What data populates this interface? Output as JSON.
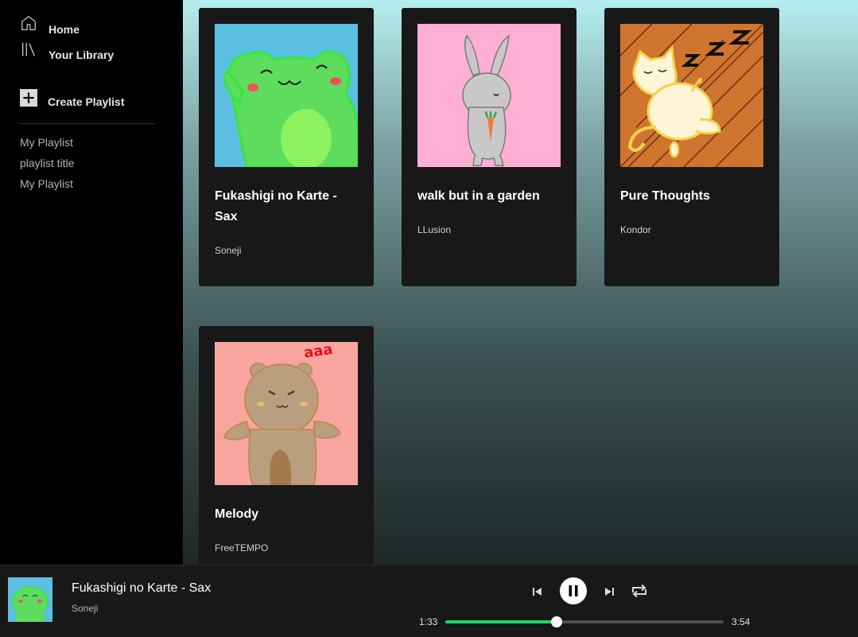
{
  "sidebar": {
    "home_label": "Home",
    "library_label": "Your Library",
    "create_playlist_label": "Create Playlist",
    "playlists": [
      "My Playlist",
      "playlist title",
      "My Playlist"
    ]
  },
  "cards": [
    {
      "title": "Fukashigi no Karte - Sax",
      "artist": "Soneji",
      "cover": "frog-illustration"
    },
    {
      "title": "walk but in a garden",
      "artist": "LLusion",
      "cover": "bunny-illustration"
    },
    {
      "title": "Pure Thoughts",
      "artist": "Kondor",
      "cover": "sleeping-cat-illustration"
    },
    {
      "title": "Melody",
      "artist": "FreeTEMPO",
      "cover": "bear-illustration",
      "cover_text": "aaa"
    }
  ],
  "player": {
    "title": "Fukashigi no Karte - Sax",
    "artist": "Soneji",
    "elapsed": "1:33",
    "duration": "3:54",
    "progress_fraction": 0.4,
    "state": "playing"
  },
  "colors": {
    "accent": "#1ed760",
    "card_bg": "#181818",
    "sidebar_bg": "#000000"
  }
}
